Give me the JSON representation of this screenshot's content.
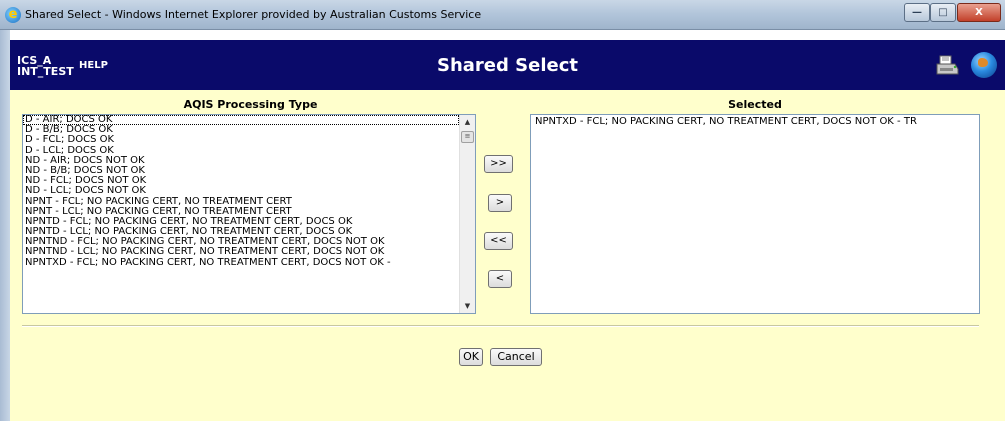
{
  "window": {
    "title": "Shared Select - Windows Internet Explorer provided by Australian Customs Service",
    "minimize_glyph": "—",
    "maximize_glyph": "□",
    "close_glyph": "X"
  },
  "header": {
    "env_line1": "ICS_A",
    "env_line2": "INT_TEST",
    "help_label": "HELP",
    "title": "Shared Select",
    "icons": [
      "print-icon",
      "globe-icon"
    ],
    "background_color": "#0a0a6a"
  },
  "available": {
    "title": "AQIS Processing Type",
    "items": [
      "D - AIR; DOCS OK",
      "D - B/B; DOCS OK",
      "D - FCL; DOCS OK",
      "D - LCL; DOCS OK",
      "ND - AIR; DOCS NOT OK",
      "ND - B/B; DOCS NOT OK",
      "ND - FCL; DOCS NOT OK",
      "ND - LCL; DOCS NOT OK",
      "NPNT - FCL; NO PACKING CERT, NO TREATMENT CERT",
      "NPNT - LCL; NO PACKING CERT, NO TREATMENT CERT",
      "NPNTD - FCL; NO PACKING CERT, NO TREATMENT CERT, DOCS OK",
      "NPNTD - LCL; NO PACKING CERT, NO TREATMENT CERT, DOCS OK",
      "NPNTND - FCL; NO PACKING CERT, NO TREATMENT CERT, DOCS NOT OK",
      "NPNTND - LCL; NO PACKING CERT, NO TREATMENT CERT, DOCS NOT OK",
      "NPNTXD - FCL; NO PACKING CERT, NO TREATMENT CERT, DOCS NOT OK -"
    ]
  },
  "selected": {
    "title": "Selected",
    "items": [
      "NPNTXD - FCL; NO PACKING CERT, NO TREATMENT CERT, DOCS NOT OK - TR"
    ]
  },
  "transfer_buttons": {
    "add_all": ">>",
    "add": ">",
    "remove_all": "<<",
    "remove": "<"
  },
  "actions": {
    "ok": "OK",
    "cancel": "Cancel"
  },
  "colors": {
    "content_background": "#ffffcc",
    "header_background": "#0a0a6a"
  }
}
